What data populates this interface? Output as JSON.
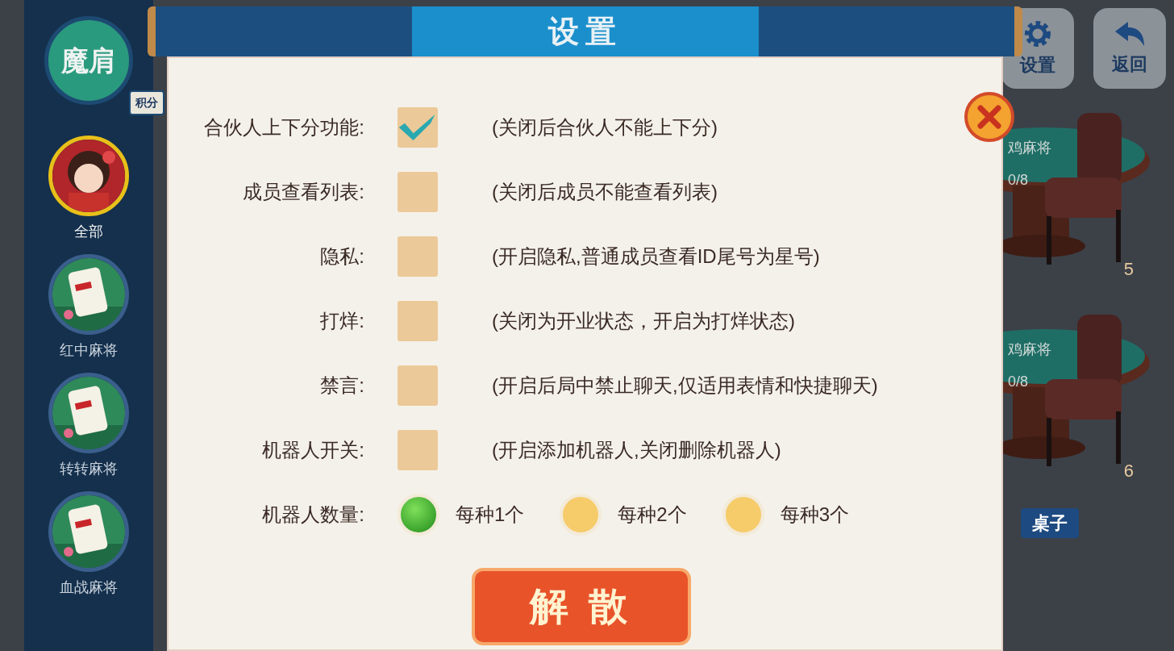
{
  "sidebar": {
    "logo": "魔肩",
    "side_tab": "积分",
    "items": [
      {
        "label": "全部",
        "selected": true
      },
      {
        "label": "红中麻将",
        "selected": false
      },
      {
        "label": "转转麻将",
        "selected": false
      },
      {
        "label": "血战麻将",
        "selected": false
      }
    ]
  },
  "top_buttons": [
    {
      "label": "设置"
    },
    {
      "label": "返回"
    }
  ],
  "tables": [
    {
      "game": "鸡麻将",
      "seats": "0/8",
      "number": "5"
    },
    {
      "game": "鸡麻将",
      "seats": "0/8",
      "number": "6"
    }
  ],
  "bottom_button": "桌子",
  "dialog": {
    "title": "设置",
    "options": [
      {
        "kind": "checkbox",
        "label": "合伙人上下分功能:",
        "checked": true,
        "note": "(关闭后合伙人不能上下分)"
      },
      {
        "kind": "checkbox",
        "label": "成员查看列表:",
        "checked": false,
        "note": "(关闭后成员不能查看列表)"
      },
      {
        "kind": "checkbox",
        "label": "隐私:",
        "checked": false,
        "note": "(开启隐私,普通成员查看ID尾号为星号)"
      },
      {
        "kind": "checkbox",
        "label": "打烊:",
        "checked": false,
        "note": "(关闭为开业状态，开启为打烊状态)"
      },
      {
        "kind": "checkbox",
        "label": "禁言:",
        "checked": false,
        "note": "(开启后局中禁止聊天,仅适用表情和快捷聊天)"
      },
      {
        "kind": "checkbox",
        "label": "机器人开关:",
        "checked": false,
        "note": "(开启添加机器人,关闭删除机器人)"
      },
      {
        "kind": "radio",
        "label": "机器人数量:",
        "choices": [
          {
            "label": "每种1个",
            "selected": true
          },
          {
            "label": "每种2个",
            "selected": false
          },
          {
            "label": "每种3个",
            "selected": false
          }
        ]
      }
    ],
    "action": "解 散"
  }
}
